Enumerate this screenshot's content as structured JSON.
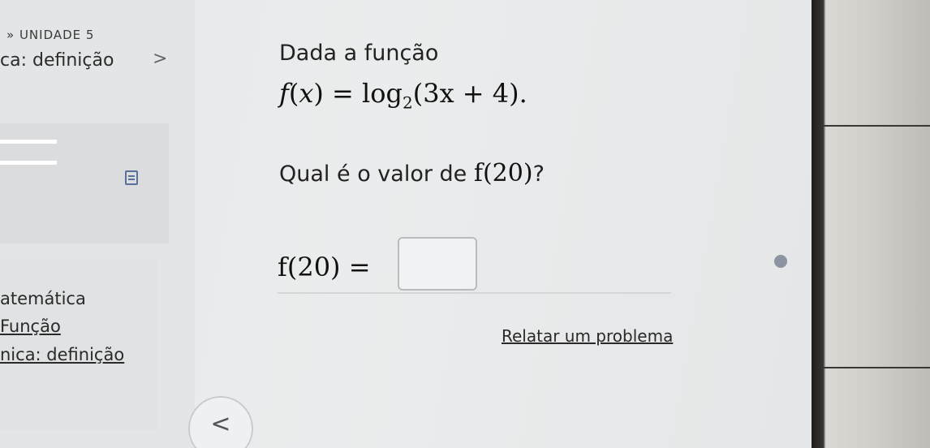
{
  "sidebar": {
    "unit_label": "» UNIDADE 5",
    "section_title": "ca: definição",
    "chevron": ">",
    "nav": [
      {
        "label": "atemática"
      },
      {
        "label": "Função"
      },
      {
        "label": "nica: definição"
      }
    ]
  },
  "question": {
    "intro": "Dada a função",
    "function_name": "f",
    "function_var": "x",
    "log_text": "log",
    "log_base": "2",
    "argument": "(3x + 4).",
    "prompt": "Qual é o valor de",
    "asked_value": "f(20)",
    "prompt_end": "?",
    "answer_label": "f(20) =",
    "answer_value": ""
  },
  "footer": {
    "report_label": "Relatar um problema",
    "back_glyph": "<"
  },
  "colors": {
    "screen_bg": "#e6e8e9",
    "text": "#222222",
    "input_border": "#b8bcc0"
  }
}
